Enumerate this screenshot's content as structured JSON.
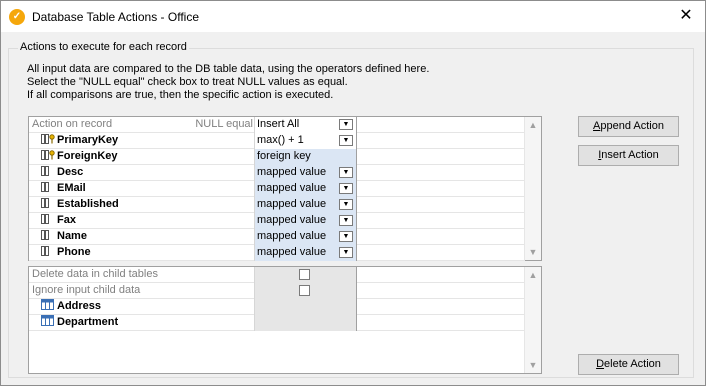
{
  "window": {
    "title": "Database Table Actions - Office",
    "close_glyph": "✕",
    "app_icon_glyph": "✓"
  },
  "group": {
    "label": "Actions to execute for each record",
    "description": [
      "All input data are compared to the DB table data, using the operators defined here.",
      "Select the \"NULL equal\" check box to treat NULL values as equal.",
      "If all comparisons are true, then the specific action is executed."
    ]
  },
  "grid1": {
    "header": {
      "label": "Action on record",
      "null_label": "NULL equal",
      "value": "Insert All"
    },
    "rows": [
      {
        "name": "PrimaryKey",
        "value": "max() + 1",
        "key": true,
        "dropdown": true,
        "white": true
      },
      {
        "name": "ForeignKey",
        "value": "foreign key",
        "key": true,
        "dropdown": false,
        "white": false
      },
      {
        "name": "Desc",
        "value": "mapped value",
        "key": false,
        "dropdown": true,
        "white": false
      },
      {
        "name": "EMail",
        "value": "mapped value",
        "key": false,
        "dropdown": true,
        "white": false
      },
      {
        "name": "Established",
        "value": "mapped value",
        "key": false,
        "dropdown": true,
        "white": false
      },
      {
        "name": "Fax",
        "value": "mapped value",
        "key": false,
        "dropdown": true,
        "white": false
      },
      {
        "name": "Name",
        "value": "mapped value",
        "key": false,
        "dropdown": true,
        "white": false
      },
      {
        "name": "Phone",
        "value": "mapped value",
        "key": false,
        "dropdown": true,
        "white": false
      }
    ]
  },
  "grid2": {
    "options": [
      {
        "label": "Delete data in child tables",
        "checked": false
      },
      {
        "label": "Ignore input child data",
        "checked": false
      }
    ],
    "tables": [
      "Address",
      "Department"
    ]
  },
  "buttons": {
    "append": "Append Action",
    "append_mnemonic": "A",
    "append_rest": "ppend Action",
    "insert_mnemonic": "I",
    "insert_rest": "nsert Action",
    "delete_mnemonic": "D",
    "delete_rest": "elete Action"
  },
  "colors": {
    "value_cell_bg": "#dbe6f4",
    "window_bg": "#f0f0f0",
    "app_icon": "#f5a70b"
  }
}
